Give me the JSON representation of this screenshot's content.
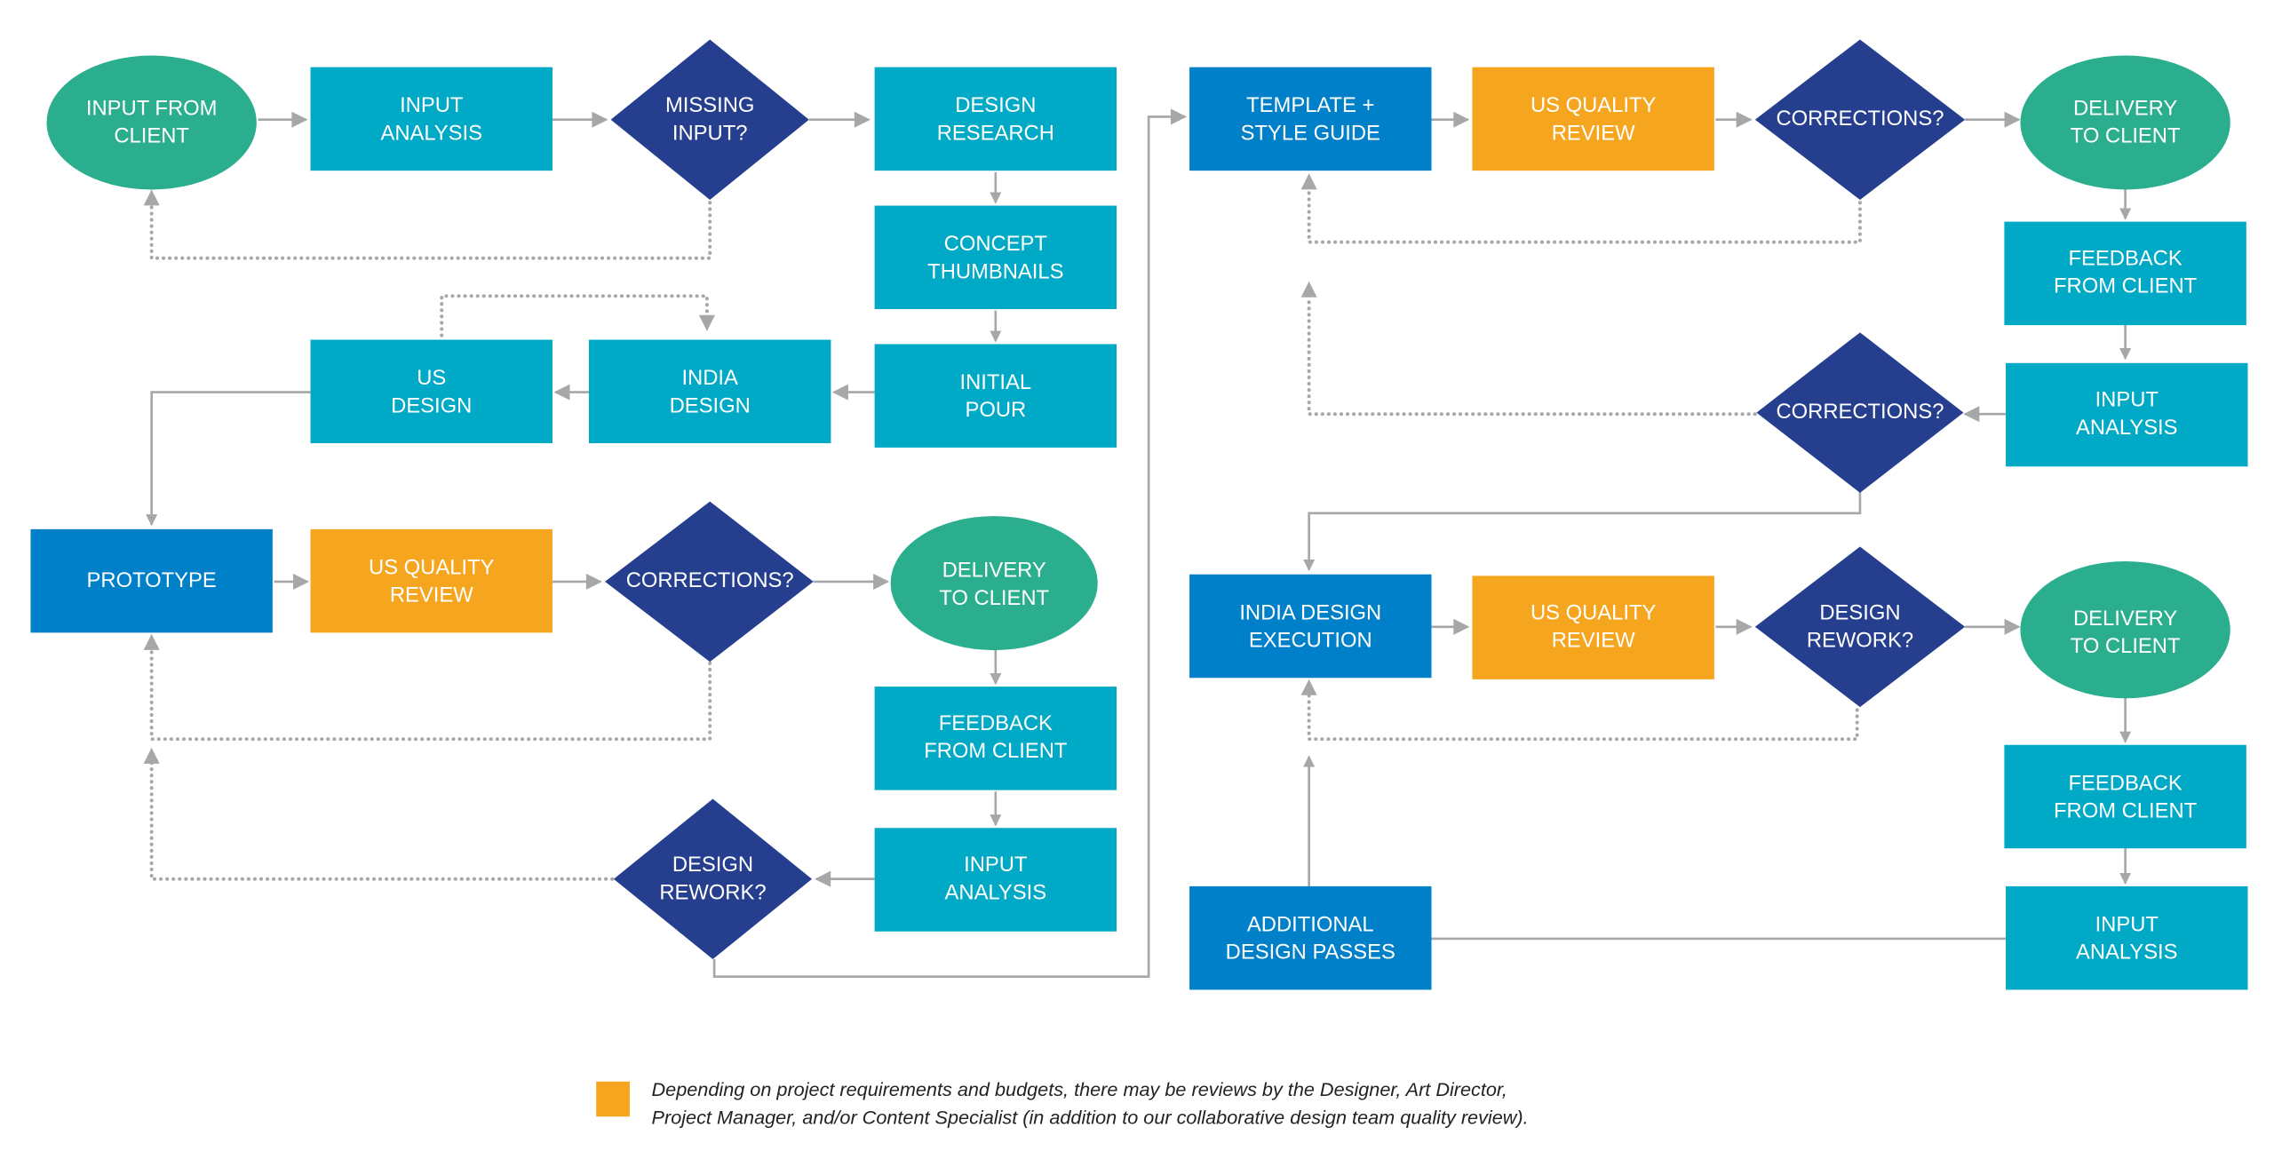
{
  "colors": {
    "process": "#00a9c5",
    "prototype_blue": "#0080c9",
    "review_orange": "#f6a51e",
    "decision_navy": "#253f8e",
    "terminal_green": "#2bae8e",
    "connector_gray": "#a6a7a9",
    "text_white": "#ffffff"
  },
  "nodes": {
    "input_from_client": [
      "INPUT FROM",
      "CLIENT"
    ],
    "input_analysis_1": [
      "INPUT",
      "ANALYSIS"
    ],
    "missing_input": [
      "MISSING",
      "INPUT?"
    ],
    "design_research": [
      "DESIGN",
      "RESEARCH"
    ],
    "concept_thumbnails": [
      "CONCEPT",
      "THUMBNAILS"
    ],
    "initial_pour": [
      "INITIAL",
      "POUR"
    ],
    "india_design": [
      "INDIA",
      "DESIGN"
    ],
    "us_design": [
      "US",
      "DESIGN"
    ],
    "prototype": [
      "PROTOTYPE"
    ],
    "us_quality_review_1": [
      "US QUALITY",
      "REVIEW"
    ],
    "corrections_1": [
      "CORRECTIONS?"
    ],
    "delivery_1": [
      "DELIVERY",
      "TO CLIENT"
    ],
    "feedback_1": [
      "FEEDBACK",
      "FROM CLIENT"
    ],
    "input_analysis_2": [
      "INPUT",
      "ANALYSIS"
    ],
    "design_rework_1": [
      "DESIGN",
      "REWORK?"
    ],
    "template_style_guide": [
      "TEMPLATE +",
      "STYLE GUIDE"
    ],
    "us_quality_review_2": [
      "US QUALITY",
      "REVIEW"
    ],
    "corrections_2": [
      "CORRECTIONS?"
    ],
    "delivery_2": [
      "DELIVERY",
      "TO CLIENT"
    ],
    "feedback_2": [
      "FEEDBACK",
      "FROM CLIENT"
    ],
    "input_analysis_3": [
      "INPUT",
      "ANALYSIS"
    ],
    "corrections_3": [
      "CORRECTIONS?"
    ],
    "india_design_execution": [
      "INDIA DESIGN",
      "EXECUTION"
    ],
    "us_quality_review_3": [
      "US QUALITY",
      "REVIEW"
    ],
    "design_rework_2": [
      "DESIGN",
      "REWORK?"
    ],
    "delivery_3": [
      "DELIVERY",
      "TO CLIENT"
    ],
    "feedback_3": [
      "FEEDBACK",
      "FROM CLIENT"
    ],
    "input_analysis_4": [
      "INPUT",
      "ANALYSIS"
    ],
    "additional_design_passes": [
      "ADDITIONAL",
      "DESIGN PASSES"
    ]
  },
  "legend": {
    "swatch_color": "#f6a51e",
    "line1": "Depending on project requirements and budgets, there may be reviews by the Designer, Art Director,",
    "line2": "Project Manager, and/or Content Specialist (in addition to our collaborative design team quality review)."
  }
}
